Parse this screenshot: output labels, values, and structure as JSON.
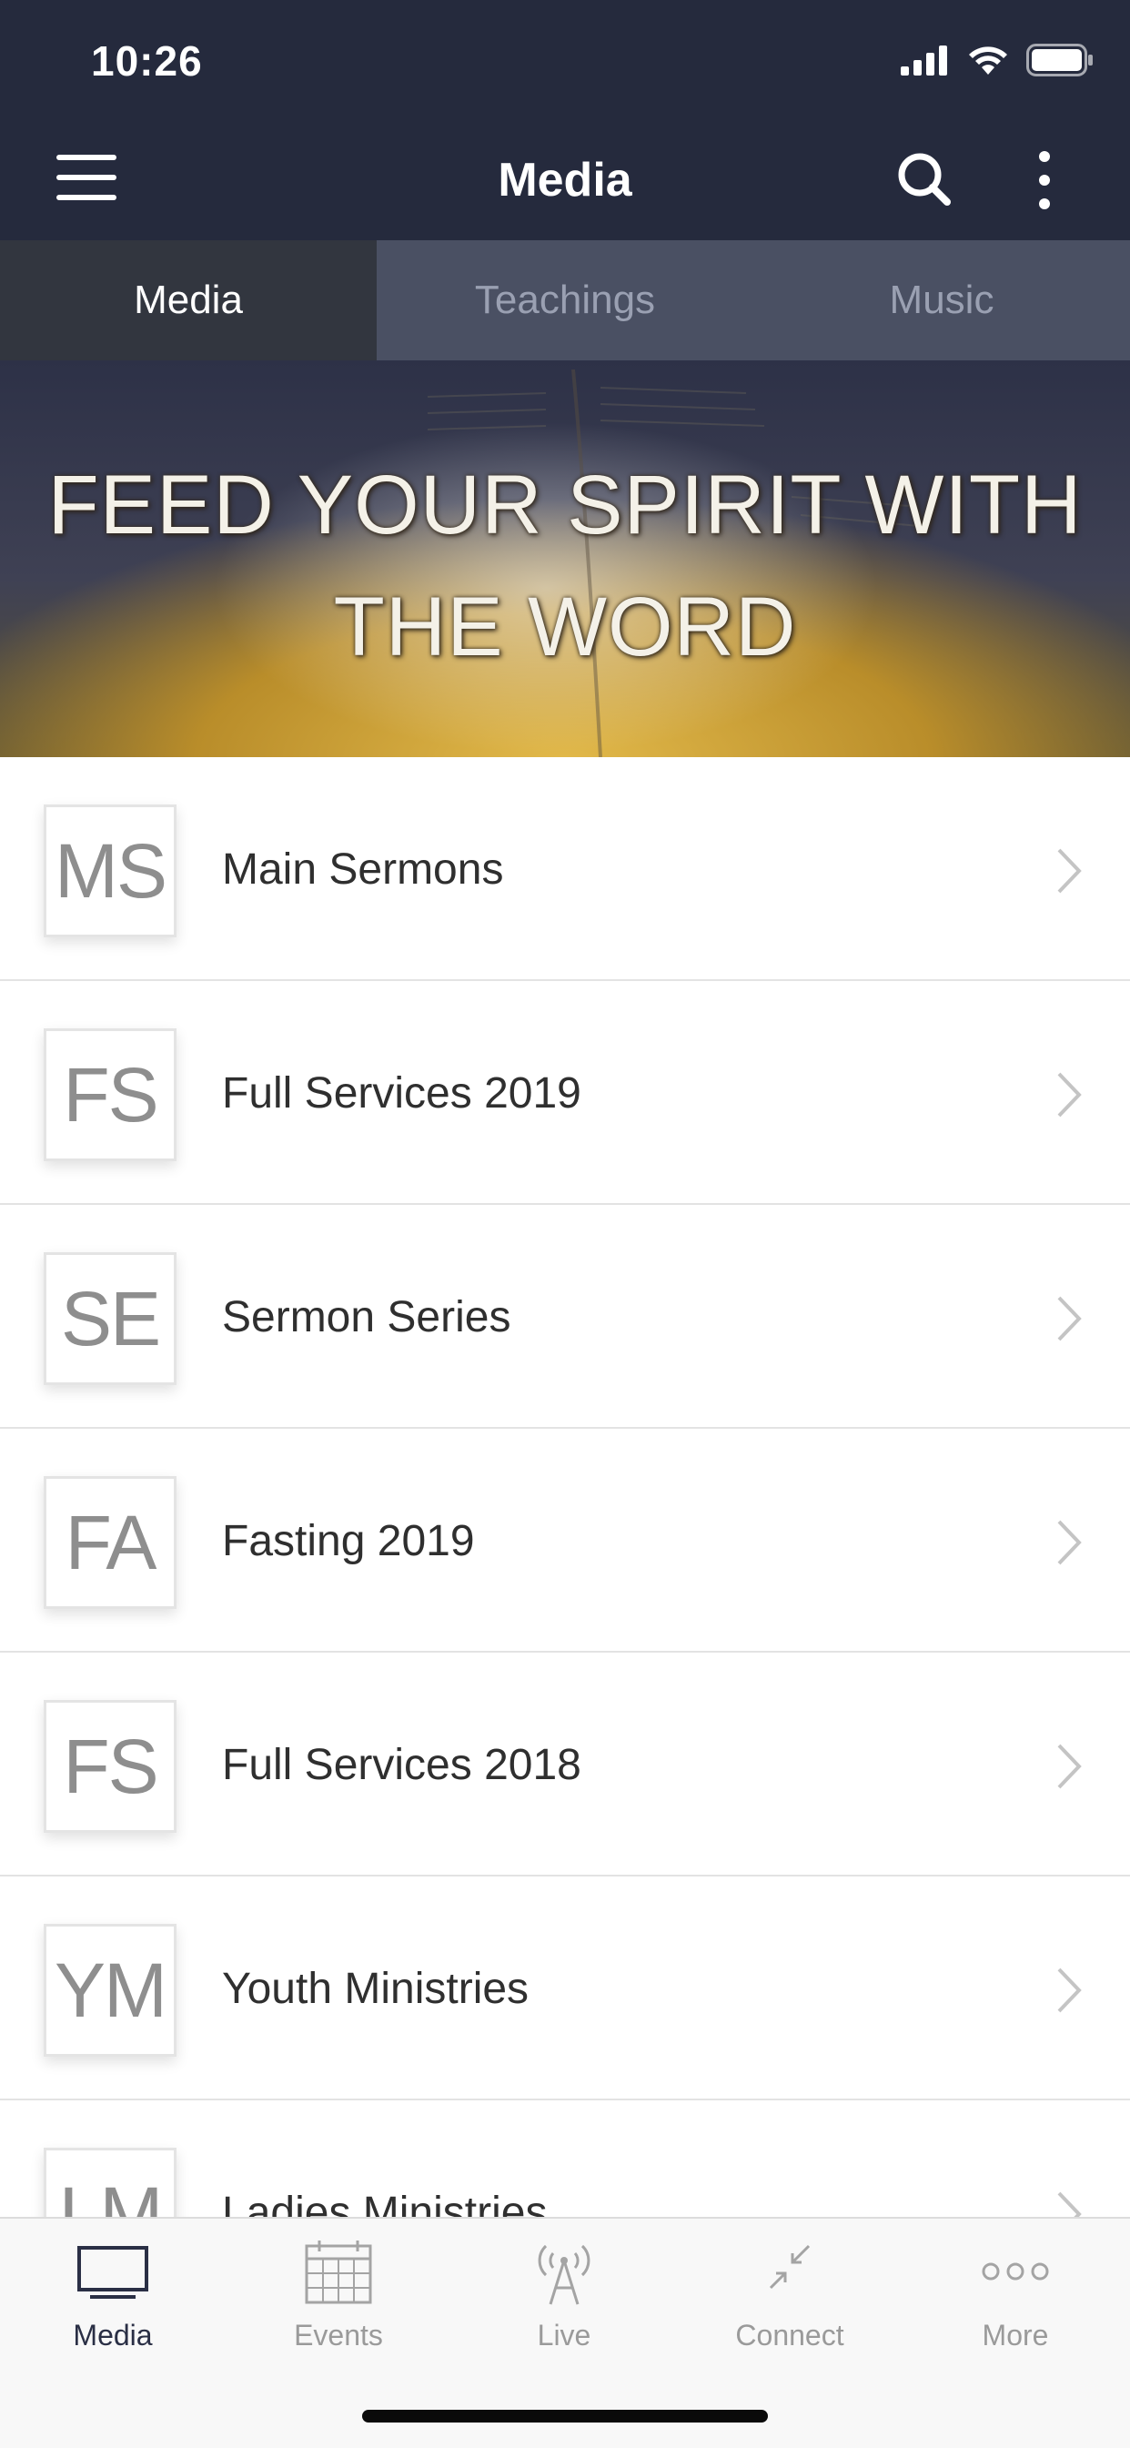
{
  "status_bar": {
    "time": "10:26"
  },
  "header": {
    "title": "Media"
  },
  "tabs": [
    {
      "label": "Media",
      "active": true
    },
    {
      "label": "Teachings",
      "active": false
    },
    {
      "label": "Music",
      "active": false
    }
  ],
  "banner": {
    "line1": "FEED YOUR SPIRIT WITH",
    "line2": "THE WORD"
  },
  "list": [
    {
      "initials": "MS",
      "label": "Main Sermons"
    },
    {
      "initials": "FS",
      "label": "Full Services 2019"
    },
    {
      "initials": "SE",
      "label": "Sermon Series"
    },
    {
      "initials": "FA",
      "label": "Fasting 2019"
    },
    {
      "initials": "FS",
      "label": "Full Services 2018"
    },
    {
      "initials": "YM",
      "label": "Youth Ministries"
    },
    {
      "initials": "LM",
      "label": "Ladies Ministries"
    }
  ],
  "bottom_nav": [
    {
      "label": "Media",
      "icon": "tv-icon",
      "active": true
    },
    {
      "label": "Events",
      "icon": "calendar-icon",
      "active": false
    },
    {
      "label": "Live",
      "icon": "broadcast-tower-icon",
      "active": false
    },
    {
      "label": "Connect",
      "icon": "connect-arrows-icon",
      "active": false
    },
    {
      "label": "More",
      "icon": "more-dots-icon",
      "active": false
    }
  ],
  "colors": {
    "header_bg": "#252a3d",
    "tab_active_bg": "#32363f",
    "tab_inactive_bg": "#4a5063"
  }
}
